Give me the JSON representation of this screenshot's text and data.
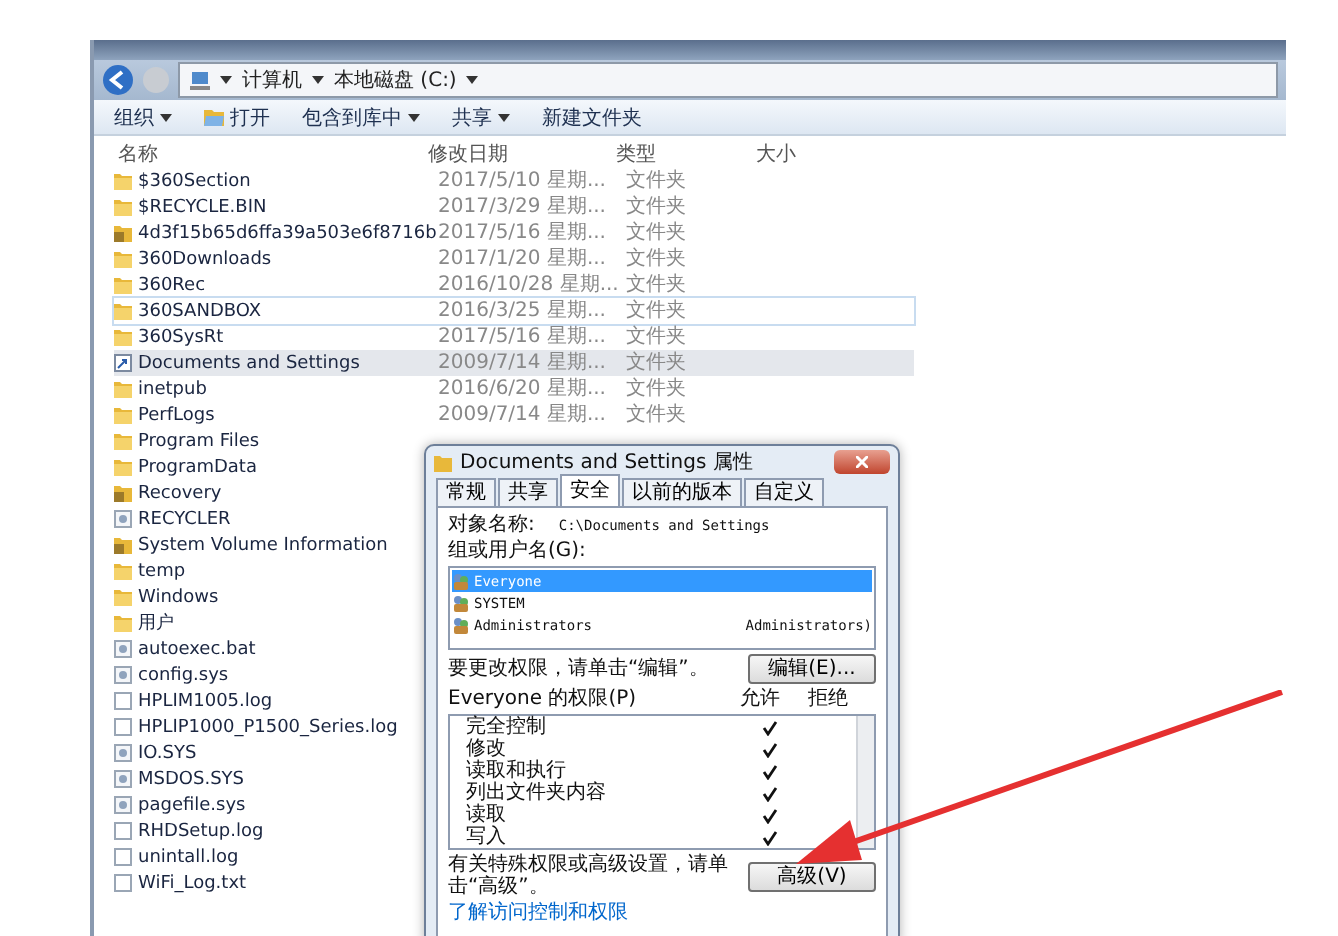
{
  "nav": {
    "breadcrumb": [
      "计算机",
      "本地磁盘 (C:)"
    ]
  },
  "toolbar": [
    {
      "label": "组织",
      "kind": "menu"
    },
    {
      "label": "打开",
      "kind": "open"
    },
    {
      "label": "包含到库中",
      "kind": "menu"
    },
    {
      "label": "共享",
      "kind": "menu"
    },
    {
      "label": "新建文件夹",
      "kind": "plain"
    }
  ],
  "columns": [
    "名称",
    "修改日期",
    "类型",
    "大小"
  ],
  "files": [
    {
      "name": "$360Section",
      "date": "2017/5/10 星期...",
      "type": "文件夹",
      "kind": "folder",
      "selected": false,
      "hovered": false
    },
    {
      "name": "$RECYCLE.BIN",
      "date": "2017/3/29 星期...",
      "type": "文件夹",
      "kind": "folder",
      "selected": false,
      "hovered": false
    },
    {
      "name": "4d3f15b65d6ffa39a503e6f8716b",
      "date": "2017/5/16 星期...",
      "type": "文件夹",
      "kind": "locked-folder",
      "selected": false,
      "hovered": false
    },
    {
      "name": "360Downloads",
      "date": "2017/1/20 星期...",
      "type": "文件夹",
      "kind": "folder",
      "selected": false,
      "hovered": false
    },
    {
      "name": "360Rec",
      "date": "2016/10/28 星期...",
      "type": "文件夹",
      "kind": "folder",
      "selected": false,
      "hovered": false
    },
    {
      "name": "360SANDBOX",
      "date": "2016/3/25 星期...",
      "type": "文件夹",
      "kind": "folder",
      "selected": false,
      "hovered": true
    },
    {
      "name": "360SysRt",
      "date": "2017/5/16 星期...",
      "type": "文件夹",
      "kind": "folder",
      "selected": false,
      "hovered": false
    },
    {
      "name": "Documents and Settings",
      "date": "2009/7/14 星期...",
      "type": "文件夹",
      "kind": "shortcut",
      "selected": true,
      "hovered": false
    },
    {
      "name": "inetpub",
      "date": "2016/6/20 星期...",
      "type": "文件夹",
      "kind": "folder",
      "selected": false,
      "hovered": false
    },
    {
      "name": "PerfLogs",
      "date": "2009/7/14 星期...",
      "type": "文件夹",
      "kind": "folder",
      "selected": false,
      "hovered": false
    },
    {
      "name": "Program Files",
      "kind": "folder",
      "selected": false,
      "hovered": false
    },
    {
      "name": "ProgramData",
      "kind": "folder",
      "selected": false,
      "hovered": false
    },
    {
      "name": "Recovery",
      "kind": "locked-folder",
      "selected": false,
      "hovered": false
    },
    {
      "name": "RECYCLER",
      "kind": "system-file",
      "selected": false,
      "hovered": false
    },
    {
      "name": "System Volume Information",
      "kind": "locked-folder",
      "selected": false,
      "hovered": false
    },
    {
      "name": "temp",
      "kind": "folder",
      "selected": false,
      "hovered": false
    },
    {
      "name": "Windows",
      "kind": "folder",
      "selected": false,
      "hovered": false
    },
    {
      "name": "用户",
      "kind": "folder",
      "selected": false,
      "hovered": false
    },
    {
      "name": "autoexec.bat",
      "kind": "system-file",
      "selected": false,
      "hovered": false
    },
    {
      "name": "config.sys",
      "kind": "system-file",
      "selected": false,
      "hovered": false
    },
    {
      "name": "HPLIM1005.log",
      "kind": "file",
      "selected": false,
      "hovered": false
    },
    {
      "name": "HPLIP1000_P1500_Series.log",
      "kind": "file",
      "selected": false,
      "hovered": false
    },
    {
      "name": "IO.SYS",
      "kind": "system-file",
      "selected": false,
      "hovered": false
    },
    {
      "name": "MSDOS.SYS",
      "kind": "system-file",
      "selected": false,
      "hovered": false
    },
    {
      "name": "pagefile.sys",
      "kind": "system-file",
      "selected": false,
      "hovered": false
    },
    {
      "name": "RHDSetup.log",
      "kind": "file",
      "selected": false,
      "hovered": false
    },
    {
      "name": "unintall.log",
      "kind": "file",
      "selected": false,
      "hovered": false
    },
    {
      "name": "WiFi_Log.txt",
      "kind": "file",
      "selected": false,
      "hovered": false
    }
  ],
  "dialog": {
    "title": "Documents and Settings 属性",
    "tabs": [
      {
        "label": "常规",
        "selected": false
      },
      {
        "label": "共享",
        "selected": false
      },
      {
        "label": "安全",
        "selected": true
      },
      {
        "label": "以前的版本",
        "selected": false
      },
      {
        "label": "自定义",
        "selected": false
      }
    ],
    "object_label": "对象名称:",
    "object_value": "C:\\Documents and Settings",
    "groups_label": "组或用户名(G):",
    "users": [
      {
        "name": "Everyone",
        "selected": true
      },
      {
        "name": "SYSTEM",
        "selected": false
      },
      {
        "name": "Administrators",
        "detail": "Administrators)",
        "selected": false
      }
    ],
    "edit_hint": "要更改权限，请单击“编辑”。",
    "edit_button": "编辑(E)...",
    "perm_label": "Everyone 的权限(P)",
    "allow_label": "允许",
    "deny_label": "拒绝",
    "permissions": [
      {
        "name": "完全控制",
        "allow": true,
        "deny": false
      },
      {
        "name": "修改",
        "allow": true,
        "deny": false
      },
      {
        "name": "读取和执行",
        "allow": true,
        "deny": false
      },
      {
        "name": "列出文件夹内容",
        "allow": true,
        "deny": false
      },
      {
        "name": "读取",
        "allow": true,
        "deny": false
      },
      {
        "name": "写入",
        "allow": true,
        "deny": false
      }
    ],
    "advanced_hint": "有关特殊权限或高级设置，请单击“高级”。",
    "advanced_button": "高级(V)",
    "link": "了解访问控制和权限"
  }
}
